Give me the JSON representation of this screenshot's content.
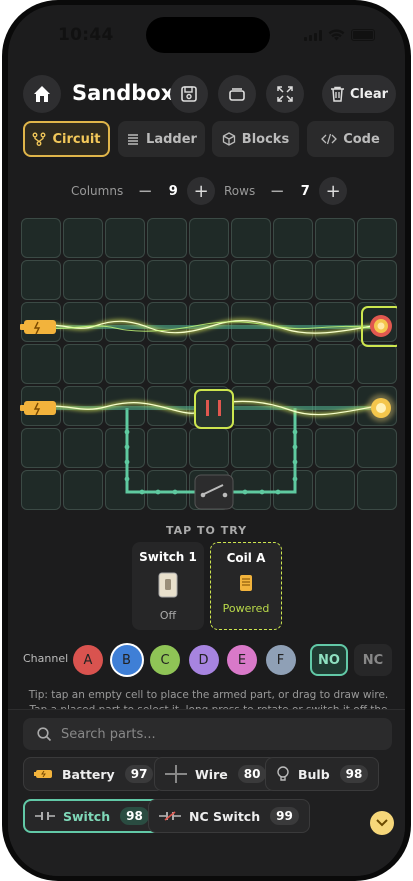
{
  "status": {
    "time": "10:44"
  },
  "header": {
    "title": "Sandbox",
    "clear_label": "Clear"
  },
  "tabs": [
    {
      "label": "Circuit",
      "icon": "circuit-icon",
      "active": true
    },
    {
      "label": "Ladder",
      "icon": "list-icon",
      "active": false
    },
    {
      "label": "Blocks",
      "icon": "cube-icon",
      "active": false
    },
    {
      "label": "Code",
      "icon": "code-icon",
      "active": false
    }
  ],
  "dimensions": {
    "columns_label": "Columns",
    "columns": "9",
    "rows_label": "Rows",
    "rows": "7"
  },
  "try": {
    "label": "TAP TO TRY",
    "cards": [
      {
        "title": "Switch 1",
        "state": "Off"
      },
      {
        "title": "Coil A",
        "state": "Powered"
      }
    ]
  },
  "channel": {
    "label": "Channel",
    "options": [
      {
        "label": "A",
        "color": "#d9534f"
      },
      {
        "label": "B",
        "color": "#3f7fd6",
        "selected": true
      },
      {
        "label": "C",
        "color": "#8fc456"
      },
      {
        "label": "D",
        "color": "#a784e0"
      },
      {
        "label": "E",
        "color": "#d979c9"
      },
      {
        "label": "F",
        "color": "#8fa0b6"
      }
    ],
    "no_label": "NO",
    "nc_label": "NC"
  },
  "tip": "Tip: tap an empty cell to place the armed part, or drag to draw wire. Tap a placed part to select it, long press to rotate or switch it off the board to remove it. A",
  "search": {
    "placeholder": "Search parts..."
  },
  "parts": [
    {
      "label": "Battery",
      "count": "97",
      "icon": "battery-icon"
    },
    {
      "label": "Wire",
      "count": "80",
      "icon": "wire-icon"
    },
    {
      "label": "Bulb",
      "count": "98",
      "icon": "bulb-icon"
    },
    {
      "label": "Switch",
      "count": "98",
      "icon": "switch-icon",
      "active": true
    },
    {
      "label": "NC Switch",
      "count": "99",
      "icon": "nc-switch-icon"
    }
  ],
  "colors": {
    "accent": "#e0b54a",
    "wire": "#5fcaa0",
    "current": "#e6f25a",
    "background": "#1c1c1d"
  }
}
